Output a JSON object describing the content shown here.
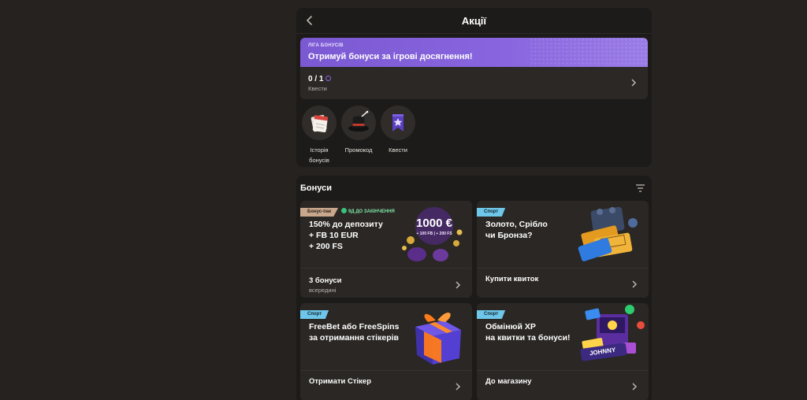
{
  "header": {
    "title": "Акції"
  },
  "league": {
    "tag": "ЛІГА БОНУСІВ",
    "headline": "Отримуй бонуси за ігрові досягнення!",
    "progress": "0 / 1",
    "sub": "Квести"
  },
  "quick_actions": [
    {
      "label": "Історія\nбонусів",
      "icon": "calendar-icon"
    },
    {
      "label": "Промокод",
      "icon": "magic-hat-icon"
    },
    {
      "label": "Квести",
      "icon": "star-bookmark-icon"
    }
  ],
  "bonuses": {
    "title": "Бонуси",
    "cards": [
      {
        "tag": "Бонус-пак",
        "expiry": "9Д ДО ЗАКІНЧЕННЯ",
        "title": "150% до депозиту\n+ FB 10 EUR\n+ 200 FS",
        "art_amount": "1000 €",
        "art_sub": "+ 100 FB | + 200 FS",
        "footer": "3 бонуси",
        "footer_sub": "всередині"
      },
      {
        "tag": "Спорт",
        "title": "Золото, Срібло\nчи Бронза?",
        "footer": "Купити квиток"
      },
      {
        "tag": "Спорт",
        "title": "FreeBet або FreeSpins\nза отримання стікерів",
        "footer": "Отримати Стікер"
      },
      {
        "tag": "Спорт",
        "title": "Обмінюй XP\nна квитки та бонуси!",
        "art_text": "JOHNNY",
        "footer": "До магазину"
      }
    ]
  },
  "colors": {
    "accent": "#8966df",
    "sport_tag": "#6ec6e8",
    "pack_tag": "#c8a78c",
    "background": "#26221f",
    "panel": "#1d1b19",
    "card": "#2a2724"
  }
}
